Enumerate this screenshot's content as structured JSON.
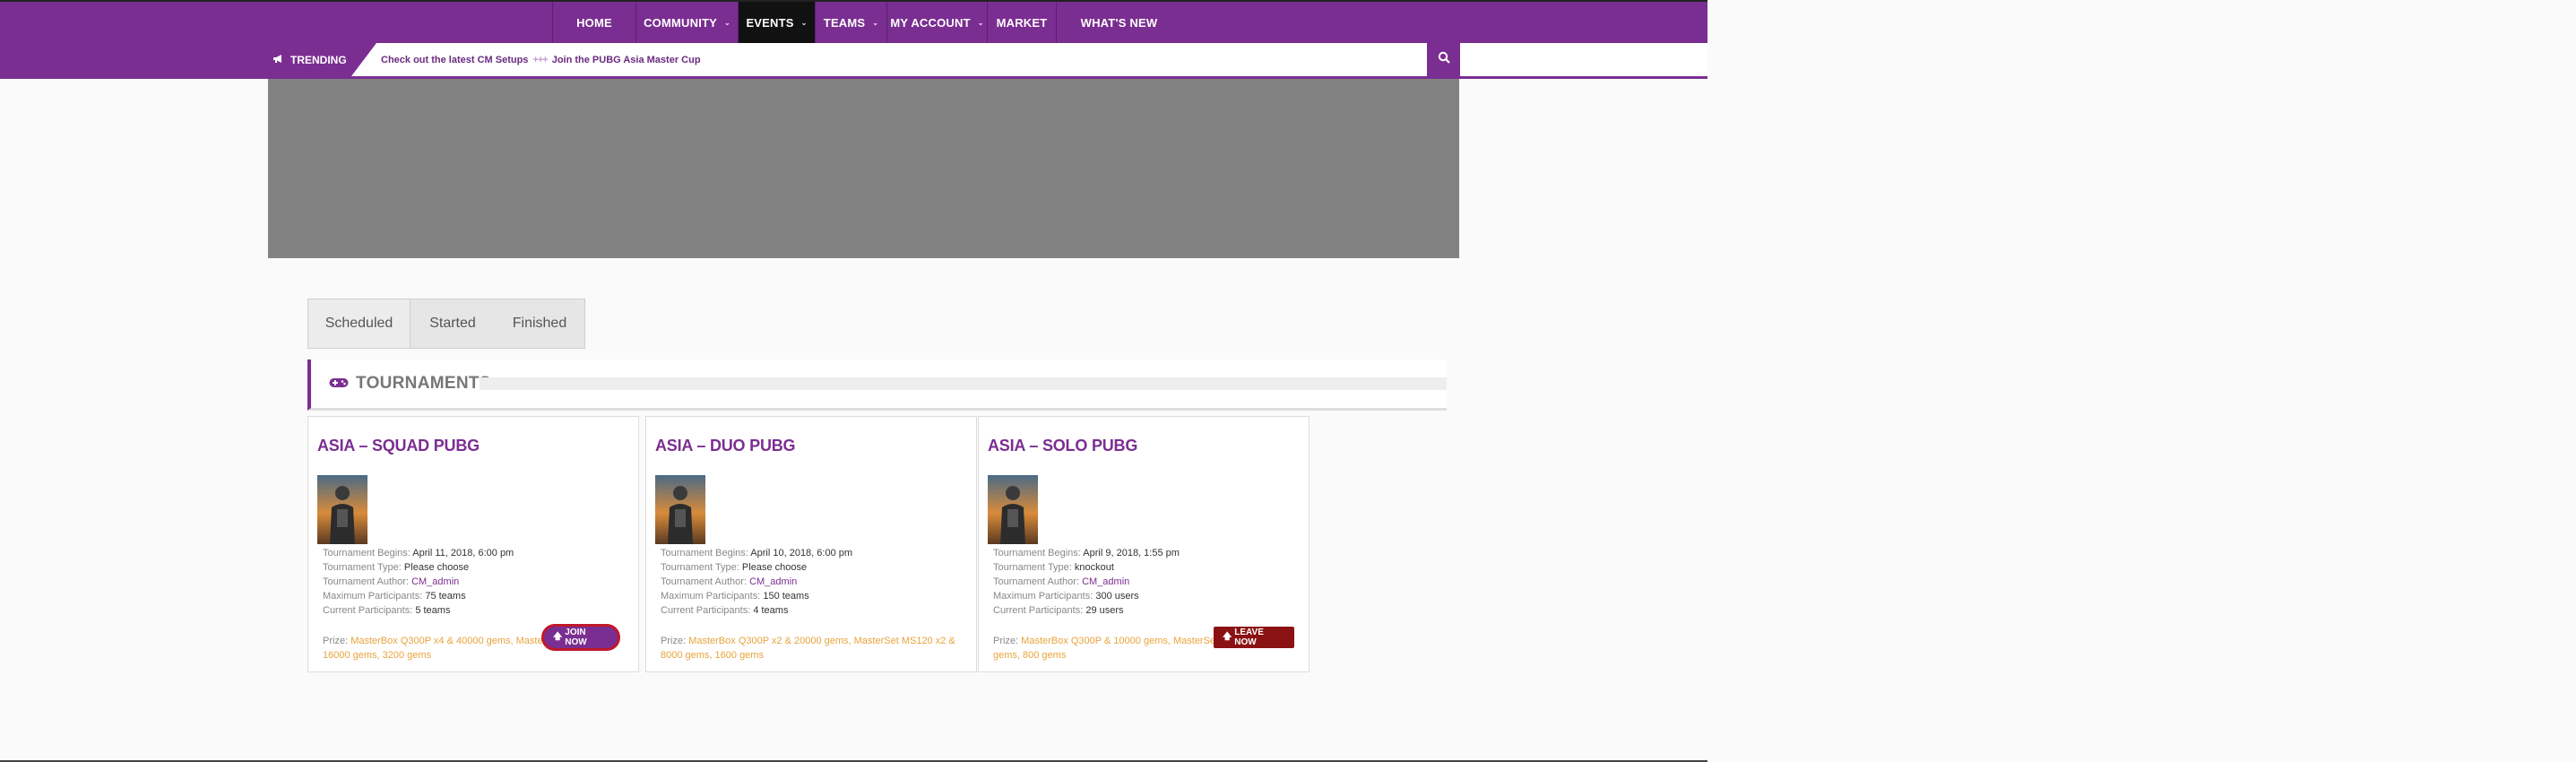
{
  "nav": {
    "items": [
      {
        "label": "HOME",
        "has_dropdown": false,
        "active": false
      },
      {
        "label": "COMMUNITY",
        "has_dropdown": true,
        "active": false
      },
      {
        "label": "EVENTS",
        "has_dropdown": true,
        "active": true
      },
      {
        "label": "TEAMS",
        "has_dropdown": true,
        "active": false
      },
      {
        "label": "MY ACCOUNT",
        "has_dropdown": true,
        "active": false
      },
      {
        "label": "MARKET",
        "has_dropdown": false,
        "active": false
      },
      {
        "label": "WHAT'S NEW",
        "has_dropdown": false,
        "active": false
      }
    ]
  },
  "trending": {
    "label": "TRENDING",
    "items": [
      "Check out the latest CM Setups",
      "Join the PUBG Asia Master Cup"
    ],
    "separator": "+++"
  },
  "tabs": [
    "Scheduled",
    "Started",
    "Finished"
  ],
  "section": {
    "title": "TOURNAMENTS"
  },
  "labels": {
    "begins": "Tournament Begins:",
    "type": "Tournament Type:",
    "author": "Tournament Author:",
    "max": "Maximum Participants:",
    "current": "Current Participants:",
    "prize": "Prize:"
  },
  "tournaments": [
    {
      "title": "ASIA – SQUAD PUBG",
      "begins": "April 11, 2018, 6:00 pm",
      "type": "Please choose",
      "author": "CM_admin",
      "max": "75 teams",
      "current": "5 teams",
      "prize": "MasterBox Q300P x4 & 40000 gems, MasterSet MS120 x4 & 16000 gems, 3200 gems",
      "button": "JOIN NOW"
    },
    {
      "title": "ASIA – DUO PUBG",
      "begins": "April 10, 2018, 6:00 pm",
      "type": "Please choose",
      "author": "CM_admin",
      "max": "150 teams",
      "current": "4 teams",
      "prize": "MasterBox Q300P x2 & 20000 gems, MasterSet MS120 x2 & 8000 gems, 1600 gems",
      "button": ""
    },
    {
      "title": "ASIA – SOLO PUBG",
      "begins": "April 9, 2018, 1:55 pm",
      "type": "knockout",
      "author": "CM_admin",
      "max": "300 users",
      "current": "29 users",
      "prize": "MasterBox Q300P & 10000 gems, MasterSet MS120 & 4000 gems, 800 gems",
      "button": "LEAVE NOW"
    }
  ],
  "colors": {
    "brand": "#7a2e91",
    "accent": "#e8a33c",
    "leave": "#8b1212",
    "highlight": "#c0182a"
  }
}
